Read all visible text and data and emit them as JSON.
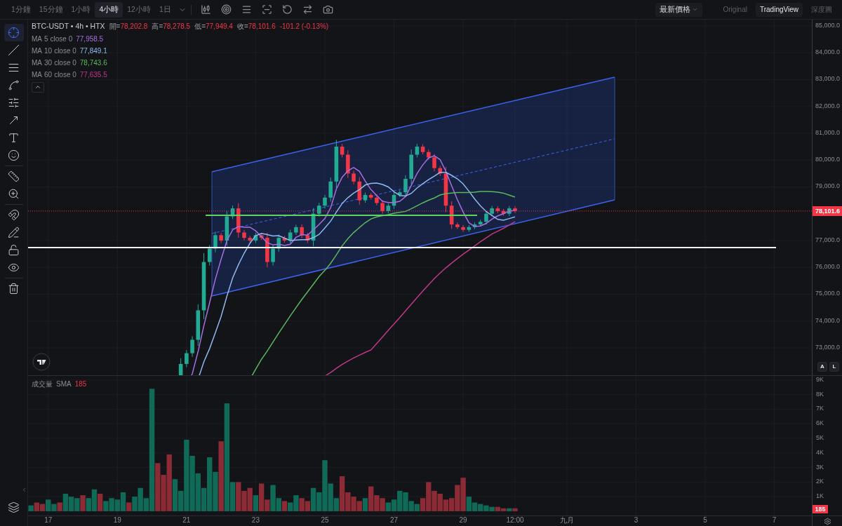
{
  "timeframes": [
    {
      "label": "1分鐘",
      "selected": false
    },
    {
      "label": "15分鐘",
      "selected": false
    },
    {
      "label": "1小時",
      "selected": false
    },
    {
      "label": "4小時",
      "selected": true
    },
    {
      "label": "12小時",
      "selected": false
    },
    {
      "label": "1日",
      "selected": false
    }
  ],
  "price_type": {
    "label": "最新價格"
  },
  "views": [
    {
      "label": "Original",
      "selected": false
    },
    {
      "label": "TradingView",
      "selected": true
    },
    {
      "label": "深度圖",
      "selected": false
    }
  ],
  "tools": [
    {
      "kind": "crosshair",
      "selected": true
    },
    {
      "kind": "line",
      "selected": false
    },
    {
      "kind": "hlines",
      "selected": false
    },
    {
      "kind": "pattern",
      "selected": false
    },
    {
      "kind": "fib",
      "selected": false
    },
    {
      "kind": "arrow",
      "selected": false
    },
    {
      "kind": "text",
      "selected": false
    },
    {
      "kind": "emoji",
      "selected": false
    },
    {
      "kind": "ruler",
      "selected": false
    },
    {
      "kind": "zoom",
      "selected": false
    },
    {
      "kind": "magnet",
      "selected": false
    },
    {
      "kind": "lockdraw",
      "selected": false
    },
    {
      "kind": "unlock",
      "selected": false
    },
    {
      "kind": "eye",
      "selected": false
    },
    {
      "kind": "trash",
      "selected": false
    }
  ],
  "legend": {
    "symbol": "BTC-USDT • 4h • HTX",
    "ohlc": [
      {
        "label": "開=",
        "value": "78,202.8"
      },
      {
        "label": "高=",
        "value": "78,278.5"
      },
      {
        "label": "低=",
        "value": "77,949.4"
      },
      {
        "label": "收=",
        "value": "78,101.6"
      }
    ],
    "change": "-101.2 (-0.13%)",
    "moving_averages": [
      {
        "name": "MA",
        "period": "5",
        "source": "close 0",
        "value": "77,958.5",
        "color": "#a86ee0"
      },
      {
        "name": "MA",
        "period": "10",
        "source": "close 0",
        "value": "77,849.1",
        "color": "#8fb8ee"
      },
      {
        "name": "MA",
        "period": "30",
        "source": "close 0",
        "value": "78,743.6",
        "color": "#5cb85c"
      },
      {
        "name": "MA",
        "period": "60",
        "source": "close 0",
        "value": "77,635.5",
        "color": "#c2378c"
      }
    ]
  },
  "price_axis": {
    "labels": [
      "85,000.0",
      "84,000.0",
      "83,000.0",
      "82,000.0",
      "81,000.0",
      "80,000.0",
      "79,000.0",
      "77,000.0",
      "76,000.0",
      "75,000.0",
      "74,000.0",
      "73,000.0"
    ],
    "last_price": "78,101.6"
  },
  "scale_buttons": [
    {
      "label": "A"
    },
    {
      "label": "L"
    }
  ],
  "volume": {
    "label": "成交量",
    "indicator": "SMA",
    "value": "185",
    "axis_labels": [
      "9K",
      "8K",
      "7K",
      "6K",
      "5K",
      "4K",
      "3K",
      "2K",
      "1K"
    ],
    "badge": "185"
  },
  "time_axis": {
    "labels": [
      "17",
      "19",
      "21",
      "23",
      "25",
      "27",
      "29",
      "12:00",
      "九月",
      "3",
      "5",
      "7"
    ]
  }
}
